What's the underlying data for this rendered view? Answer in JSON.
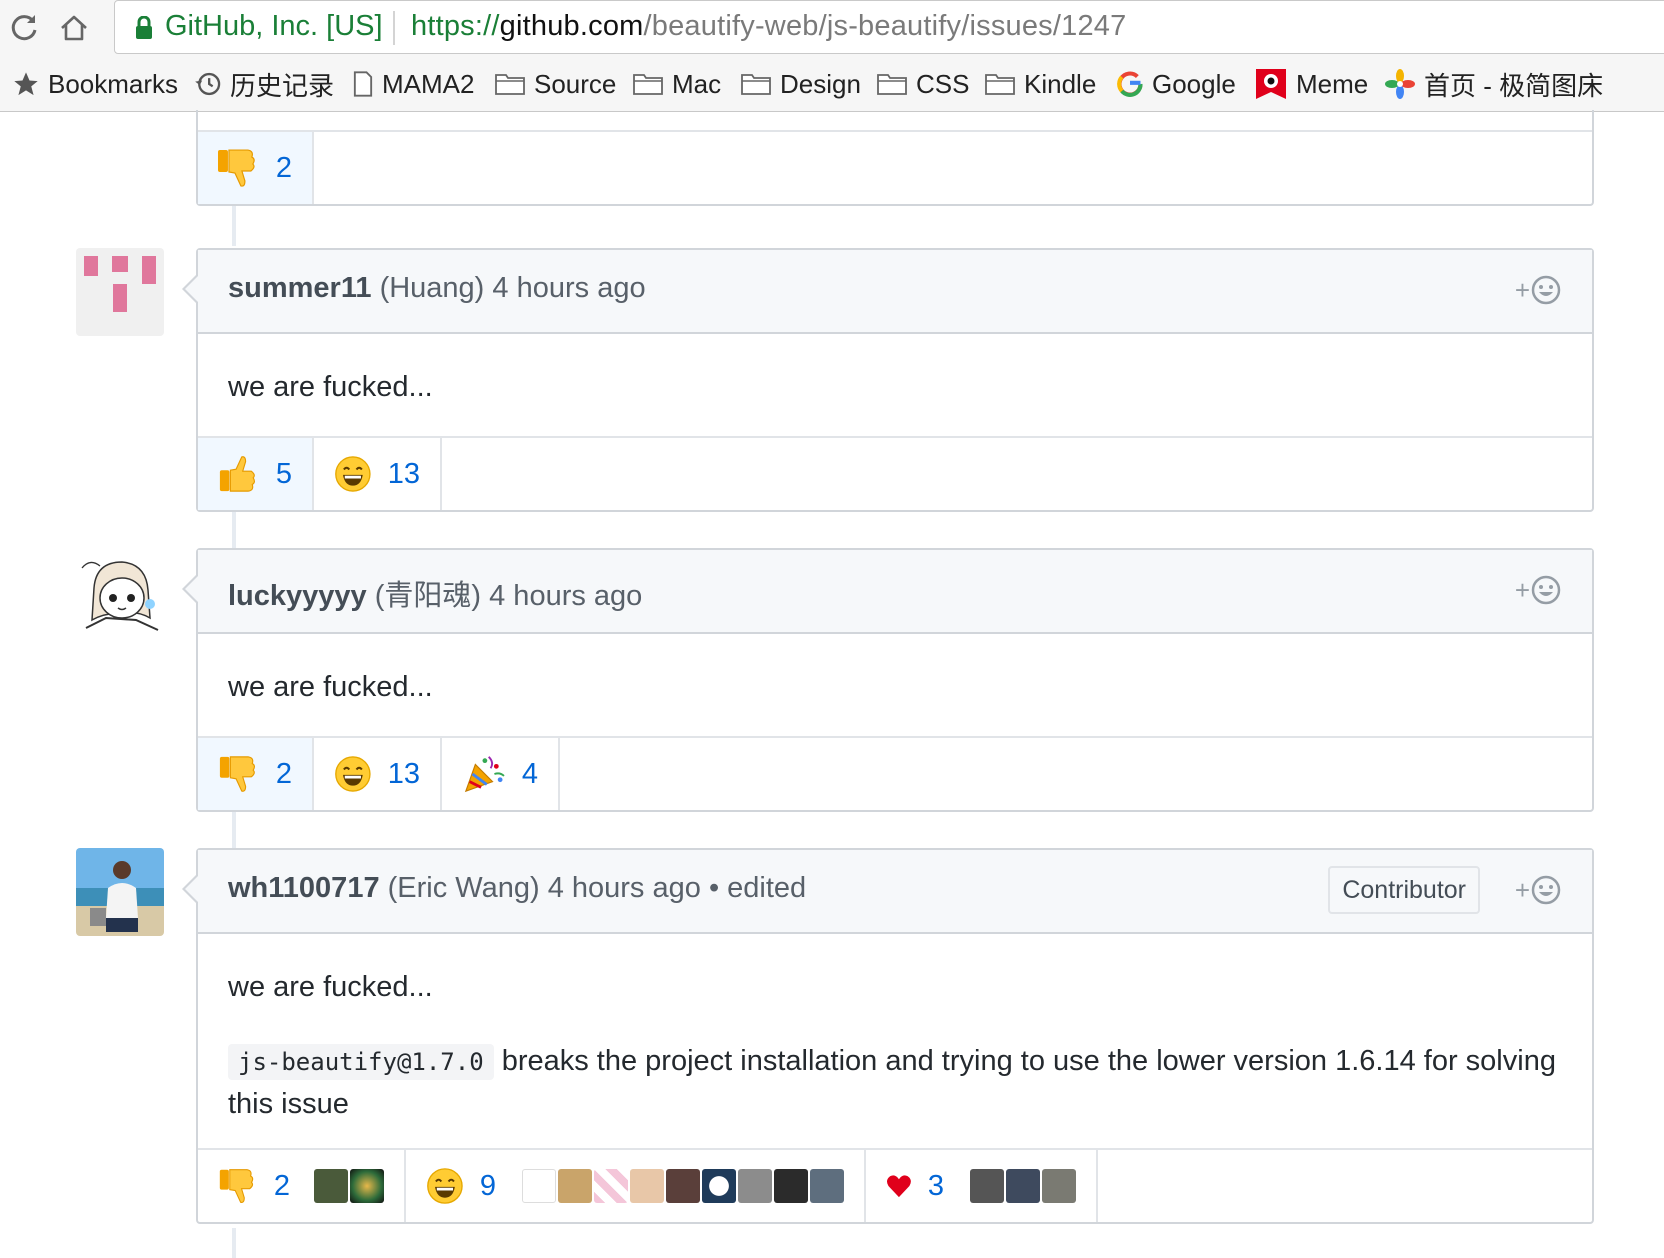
{
  "browser": {
    "site_identity": "GitHub, Inc. [US]",
    "url_scheme": "https://",
    "url_host": "github.com",
    "url_path": "/beautify-web/js-beautify/issues/1247",
    "bookmarks": [
      {
        "label": "Bookmarks",
        "icon": "star-icon"
      },
      {
        "label": "历史记录",
        "icon": "history-icon"
      },
      {
        "label": "MAMA2",
        "icon": "page-icon"
      },
      {
        "label": "Source",
        "icon": "folder-icon"
      },
      {
        "label": "Mac",
        "icon": "folder-icon"
      },
      {
        "label": "Design",
        "icon": "folder-icon"
      },
      {
        "label": "CSS",
        "icon": "folder-icon"
      },
      {
        "label": "Kindle",
        "icon": "folder-icon"
      },
      {
        "label": "Google",
        "icon": "google-icon"
      },
      {
        "label": "Meme",
        "icon": "meme-icon"
      },
      {
        "label": "首页 - 极简图床",
        "icon": "photos-icon"
      }
    ]
  },
  "top_reaction": {
    "emoji": "thumbs-down",
    "count": "2"
  },
  "comments": [
    {
      "login": "summer11",
      "name": "(Huang)",
      "time": "4 hours ago",
      "body": "we are fucked...",
      "reactions": [
        {
          "emoji": "thumbs-up",
          "count": "5"
        },
        {
          "emoji": "smile",
          "count": "13"
        }
      ]
    },
    {
      "login": "luckyyyyy",
      "name": "(青阳魂)",
      "time": "4 hours ago",
      "body": "we are fucked...",
      "reactions": [
        {
          "emoji": "thumbs-down",
          "count": "2"
        },
        {
          "emoji": "smile",
          "count": "13"
        },
        {
          "emoji": "tada",
          "count": "4"
        }
      ]
    },
    {
      "login": "wh1100717",
      "name": "(Eric Wang)",
      "time": "4 hours ago",
      "edited": "• edited",
      "badge": "Contributor",
      "body": "we are fucked...",
      "code": "js-beautify@1.7.0",
      "body2": " breaks the project installation and trying to use the lower version 1.6.14 for solving this issue",
      "reactions": [
        {
          "emoji": "thumbs-down",
          "count": "2"
        },
        {
          "emoji": "smile",
          "count": "9"
        },
        {
          "emoji": "heart",
          "count": "3"
        }
      ]
    }
  ],
  "add_reaction_glyph": "+",
  "colors": {
    "link": "#0366d6",
    "border": "#d1d5da",
    "header_bg": "#f6f8fa",
    "reaction_active_bg": "#f1f8ff"
  }
}
